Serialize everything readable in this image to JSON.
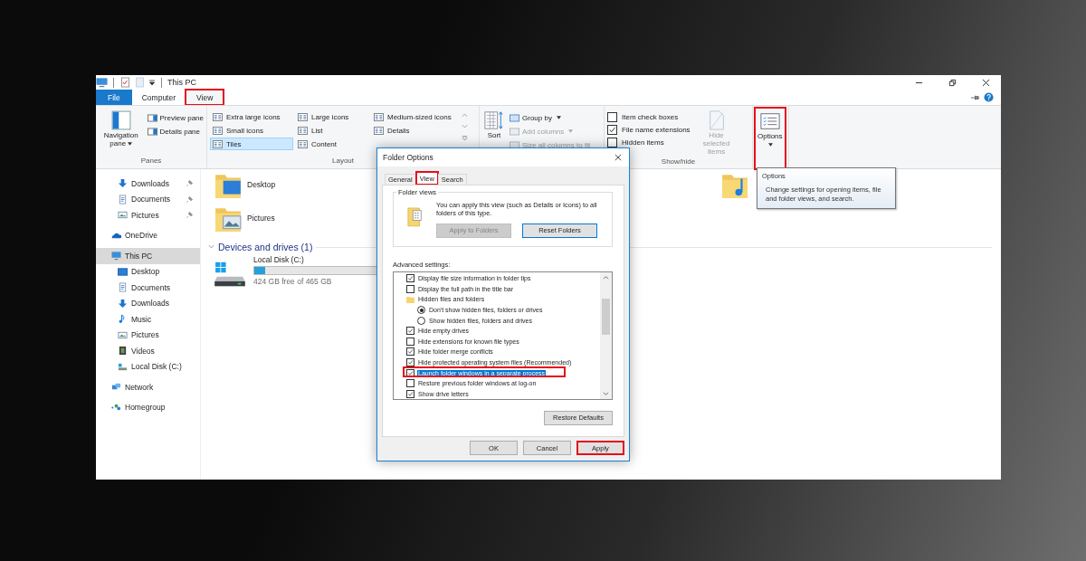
{
  "window": {
    "title": "This PC"
  },
  "ribbon_tabs": [
    {
      "label": "File",
      "kind": "file",
      "selected": false,
      "highlighted": false
    },
    {
      "label": "Computer",
      "kind": "tab",
      "selected": false,
      "highlighted": false
    },
    {
      "label": "View",
      "kind": "tab",
      "selected": true,
      "highlighted": true
    }
  ],
  "panes_group": {
    "name": "Panes",
    "navigation_pane": "Navigation pane",
    "preview_pane": "Preview pane",
    "details_pane": "Details pane"
  },
  "layout_group": {
    "name": "Layout",
    "options": [
      {
        "label": "Extra large icons",
        "selected": false
      },
      {
        "label": "Large icons",
        "selected": false
      },
      {
        "label": "Medium-sized icons",
        "selected": false
      },
      {
        "label": "Small icons",
        "selected": false
      },
      {
        "label": "List",
        "selected": false
      },
      {
        "label": "Details",
        "selected": false
      },
      {
        "label": "Tiles",
        "selected": true
      },
      {
        "label": "Content",
        "selected": false
      }
    ]
  },
  "current_view_group": {
    "sort": "Sort",
    "commands": [
      {
        "label": "Group by",
        "disabled": false,
        "dropdown": true
      },
      {
        "label": "Add columns",
        "disabled": true,
        "dropdown": true
      },
      {
        "label": "Size all columns to fit",
        "disabled": true,
        "dropdown": false
      }
    ]
  },
  "show_hide_group": {
    "name": "Show/hide",
    "checkboxes": [
      {
        "label": "Item check boxes",
        "checked": false
      },
      {
        "label": "File name extensions",
        "checked": true
      },
      {
        "label": "Hidden items",
        "checked": false
      }
    ],
    "hide_selected_items": {
      "label": "Hide selected items",
      "disabled": true
    }
  },
  "options_button": {
    "label": "Options",
    "highlighted": true
  },
  "navigation_pane": {
    "quick_access_items": [
      {
        "label": "Downloads",
        "kind": "downloads",
        "pinned": true,
        "selected": false
      },
      {
        "label": "Documents",
        "kind": "documents",
        "pinned": true,
        "selected": false
      },
      {
        "label": "Pictures",
        "kind": "pictures",
        "pinned": true,
        "selected": false
      }
    ],
    "items": [
      {
        "label": "OneDrive",
        "kind": "onedrive",
        "selected": false
      },
      {
        "label": "This PC",
        "kind": "pc",
        "selected": true,
        "children": [
          {
            "label": "Desktop",
            "kind": "desktop",
            "selected": false
          },
          {
            "label": "Documents",
            "kind": "documents",
            "selected": false
          },
          {
            "label": "Downloads",
            "kind": "downloads",
            "selected": false
          },
          {
            "label": "Music",
            "kind": "music",
            "selected": false
          },
          {
            "label": "Pictures",
            "kind": "pictures",
            "selected": false
          },
          {
            "label": "Videos",
            "kind": "videos",
            "selected": false
          },
          {
            "label": "Local Disk (C:)",
            "kind": "disk",
            "selected": false
          }
        ]
      },
      {
        "label": "Network",
        "kind": "network",
        "selected": false
      },
      {
        "label": "Homegroup",
        "kind": "homegroup",
        "selected": false
      }
    ]
  },
  "content": {
    "folders": [
      {
        "name": "Desktop",
        "kind": "desktop"
      },
      {
        "kind": "music"
      },
      {
        "name": "Pictures",
        "kind": "pictures"
      }
    ],
    "section": {
      "title": "Devices and drives (1)",
      "expanded": true
    },
    "drives": [
      {
        "name": "Local Disk (C:)",
        "level": 0.09,
        "space": "424 GB free of 465 GB"
      }
    ]
  },
  "dialog": {
    "title": "Folder Options",
    "tabs": [
      {
        "label": "General",
        "selected": false,
        "highlighted": false
      },
      {
        "label": "View",
        "selected": true,
        "highlighted": true
      },
      {
        "label": "Search",
        "selected": false,
        "highlighted": false
      }
    ],
    "folder_views": {
      "legend": "Folder views",
      "text": "You can apply this view (such as Details or Icons) to all folders of this type.",
      "buttons": [
        {
          "label": "Apply to Folders",
          "disabled": true
        },
        {
          "label": "Reset Folders",
          "disabled": false
        }
      ]
    },
    "advanced_label": "Advanced settings:",
    "settings": [
      {
        "kind": "checkbox",
        "label": "Display file size information in folder tips",
        "checked": true,
        "selected": false,
        "highlighted": false
      },
      {
        "kind": "checkbox",
        "label": "Display the full path in the title bar",
        "checked": false,
        "selected": false,
        "highlighted": false
      },
      {
        "kind": "folder",
        "label": "Hidden files and folders",
        "selected": false,
        "highlighted": false,
        "children": [
          {
            "kind": "radio",
            "label": "Don't show hidden files, folders or drives",
            "checked": true,
            "selected": false,
            "highlighted": false
          },
          {
            "kind": "radio",
            "label": "Show hidden files, folders and drives",
            "checked": false,
            "selected": false,
            "highlighted": false
          }
        ]
      },
      {
        "kind": "checkbox",
        "label": "Hide empty drives",
        "checked": true,
        "selected": false,
        "highlighted": false
      },
      {
        "kind": "checkbox",
        "label": "Hide extensions for known file types",
        "checked": false,
        "selected": false,
        "highlighted": false
      },
      {
        "kind": "checkbox",
        "label": "Hide folder merge conflicts",
        "checked": true,
        "selected": false,
        "highlighted": false
      },
      {
        "kind": "checkbox",
        "label": "Hide protected operating system files (Recommended)",
        "checked": true,
        "selected": false,
        "highlighted": false
      },
      {
        "kind": "checkbox",
        "label": "Launch folder windows in a separate process",
        "checked": true,
        "selected": true,
        "highlighted": true
      },
      {
        "kind": "checkbox",
        "label": "Restore previous folder windows at log-on",
        "checked": false,
        "selected": false,
        "highlighted": false
      },
      {
        "kind": "checkbox",
        "label": "Show drive letters",
        "checked": true,
        "selected": false,
        "highlighted": false
      }
    ],
    "restore_defaults": "Restore Defaults",
    "buttons": [
      {
        "label": "OK",
        "highlighted": false
      },
      {
        "label": "Cancel",
        "highlighted": false
      },
      {
        "label": "Apply",
        "highlighted": true
      }
    ]
  },
  "tooltip": {
    "title": "Options",
    "text": "Change settings for opening items, file and folder views, and search."
  }
}
